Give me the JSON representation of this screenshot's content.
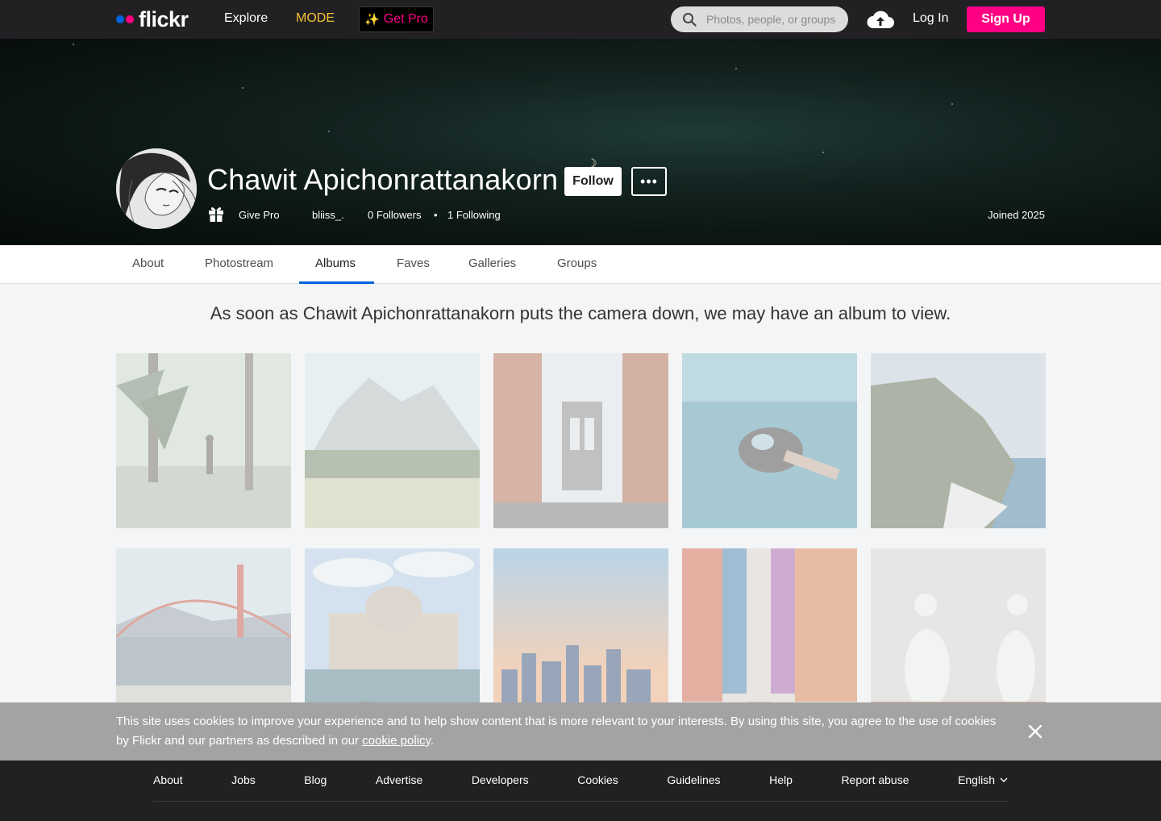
{
  "nav": {
    "brand": "flickr",
    "explore": "Explore",
    "mode": "MODE",
    "get_pro_sparkle": "✨",
    "get_pro": "Get Pro",
    "search_placeholder": "Photos, people, or groups",
    "login": "Log In",
    "signup": "Sign Up"
  },
  "profile": {
    "name": "Chawit Apichonrattanakorn",
    "follow": "Follow",
    "more": "•••",
    "give_pro": "Give Pro",
    "handle": "bliiss_.",
    "followers": "0 Followers",
    "separator": "•",
    "following": "1 Following",
    "joined": "Joined 2025"
  },
  "tabs": [
    {
      "label": "About"
    },
    {
      "label": "Photostream"
    },
    {
      "label": "Albums",
      "active": true
    },
    {
      "label": "Faves"
    },
    {
      "label": "Galleries"
    },
    {
      "label": "Groups"
    }
  ],
  "albums_empty_message": "As soon as Chawit Apichonrattanakorn puts the camera down, we may have an album to view.",
  "placeholder_tiles": [
    "forest-hiker",
    "mountain-meadow",
    "city-bridge",
    "snorkeler",
    "coastal-cliff",
    "golden-gate-bridge",
    "venice-gondola",
    "city-skyline-sunset",
    "colorful-street",
    "birds"
  ],
  "cookie_banner": {
    "text_before": "This site uses cookies to improve your experience and to help show content that is more relevant to your interests. By using this site, you agree to the use of cookies by Flickr and our partners as described in our ",
    "link": "cookie policy",
    "text_after": "."
  },
  "footer": {
    "links": [
      "About",
      "Jobs",
      "Blog",
      "Advertise",
      "Developers",
      "Cookies",
      "Guidelines",
      "Help",
      "Report abuse"
    ],
    "language": "English"
  },
  "colors": {
    "brand_blue": "#0063dc",
    "brand_pink": "#ff0084",
    "mode_yellow": "#f5c033",
    "nav_bg": "#212124"
  }
}
